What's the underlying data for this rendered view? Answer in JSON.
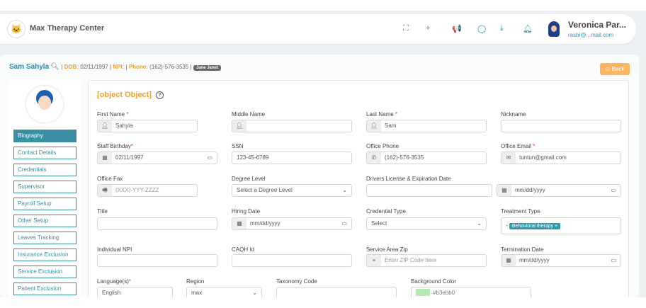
{
  "header": {
    "brand": "Max Therapy Center",
    "user_name": "Veronica Par...",
    "user_email": "rashi@...mail.com",
    "icons": [
      "fullscreen-icon",
      "plus-icon",
      "megaphone-icon",
      "chat-icon",
      "download-icon",
      "bell-icon"
    ]
  },
  "profile": {
    "name": "Sam Sahyla",
    "dob_label": "DOB:",
    "dob": "02/11/1997",
    "npi_label": "NPI:",
    "phone_label": "Phone:",
    "phone": "(162)-576-3535",
    "badge": "Jane Janet",
    "back": "Back"
  },
  "sidebar": [
    "Biography",
    "Contact Details",
    "Credentials",
    "Supervisor",
    "Payroll Setup",
    "Other Setup",
    "Leaves Tracking",
    "Insurance Exclusion",
    "Service Exclusion",
    "Patient Exclusion"
  ],
  "form": {
    "title": {
      "label": "Title",
      "value": ""
    },
    "first_name": {
      "label": "First Name",
      "value": "Sahyla"
    },
    "middle_name": {
      "label": "Middle Name",
      "value": ""
    },
    "last_name": {
      "label": "Last Name",
      "value": "Sam"
    },
    "nickname": {
      "label": "Nickname",
      "value": ""
    },
    "birthday": {
      "label": "Staff Birthday",
      "value": "02/11/1997"
    },
    "ssn": {
      "label": "SSN",
      "value": "123-45-6789"
    },
    "office_phone": {
      "label": "Office Phone",
      "value": "(162)-576-3535"
    },
    "office_email": {
      "label": "Office Email",
      "value": "tuntun@gmail.com"
    },
    "office_fax": {
      "label": "Office Fax",
      "placeholder": "(XXX)-YYY-ZZZZ"
    },
    "degree": {
      "label": "Degree Level",
      "value": "Select a Degree Level"
    },
    "license": {
      "label": "Drivers License & Expiration Date",
      "date": "mm/dd/yyyy"
    },
    "hiring": {
      "label": "Hiring Date",
      "value": "mm/dd/yyyy"
    },
    "cred_type": {
      "label": "Credential Type",
      "value": "Select"
    },
    "treatment": {
      "label": "Treatment Type",
      "value": "Behavioral therapy"
    },
    "npi": {
      "label": "Individual NPI",
      "value": ""
    },
    "caqh": {
      "label": "CAQH Id",
      "value": ""
    },
    "zip": {
      "label": "Service Area Zip",
      "placeholder": "Enter ZIP Code here"
    },
    "termination": {
      "label": "Termination Date",
      "value": "mm/dd/yyyy"
    },
    "language": {
      "label": "Language(s)",
      "value": "English"
    },
    "region": {
      "label": "Region",
      "value": "max"
    },
    "taxonomy": {
      "label": "Taxonomy Code",
      "value": ""
    },
    "bgcolor": {
      "label": "Background Color",
      "value": "#b3ebb0"
    }
  }
}
